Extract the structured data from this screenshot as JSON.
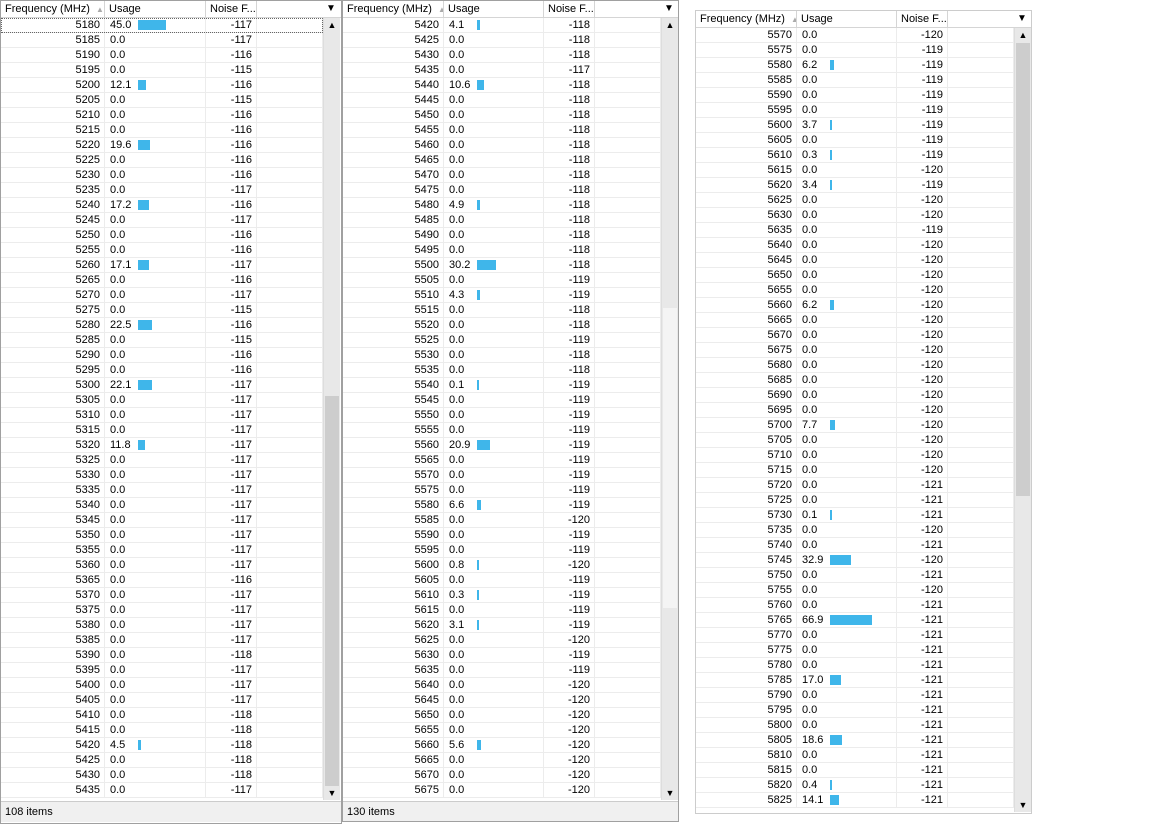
{
  "headers": {
    "frequency": "Frequency (MHz)",
    "usage": "Usage",
    "noise": "Noise F..."
  },
  "colors": {
    "bar": "#3fb6ea"
  },
  "panels": [
    {
      "status": "108 items",
      "rows": [
        [
          "5180",
          "45.0",
          "-117"
        ],
        [
          "5185",
          "0.0",
          "-117"
        ],
        [
          "5190",
          "0.0",
          "-116"
        ],
        [
          "5195",
          "0.0",
          "-115"
        ],
        [
          "5200",
          "12.1",
          "-116"
        ],
        [
          "5205",
          "0.0",
          "-115"
        ],
        [
          "5210",
          "0.0",
          "-116"
        ],
        [
          "5215",
          "0.0",
          "-116"
        ],
        [
          "5220",
          "19.6",
          "-116"
        ],
        [
          "5225",
          "0.0",
          "-116"
        ],
        [
          "5230",
          "0.0",
          "-116"
        ],
        [
          "5235",
          "0.0",
          "-117"
        ],
        [
          "5240",
          "17.2",
          "-116"
        ],
        [
          "5245",
          "0.0",
          "-117"
        ],
        [
          "5250",
          "0.0",
          "-116"
        ],
        [
          "5255",
          "0.0",
          "-116"
        ],
        [
          "5260",
          "17.1",
          "-117"
        ],
        [
          "5265",
          "0.0",
          "-116"
        ],
        [
          "5270",
          "0.0",
          "-117"
        ],
        [
          "5275",
          "0.0",
          "-115"
        ],
        [
          "5280",
          "22.5",
          "-116"
        ],
        [
          "5285",
          "0.0",
          "-115"
        ],
        [
          "5290",
          "0.0",
          "-116"
        ],
        [
          "5295",
          "0.0",
          "-116"
        ],
        [
          "5300",
          "22.1",
          "-117"
        ],
        [
          "5305",
          "0.0",
          "-117"
        ],
        [
          "5310",
          "0.0",
          "-117"
        ],
        [
          "5315",
          "0.0",
          "-117"
        ],
        [
          "5320",
          "11.8",
          "-117"
        ],
        [
          "5325",
          "0.0",
          "-117"
        ],
        [
          "5330",
          "0.0",
          "-117"
        ],
        [
          "5335",
          "0.0",
          "-117"
        ],
        [
          "5340",
          "0.0",
          "-117"
        ],
        [
          "5345",
          "0.0",
          "-117"
        ],
        [
          "5350",
          "0.0",
          "-117"
        ],
        [
          "5355",
          "0.0",
          "-117"
        ],
        [
          "5360",
          "0.0",
          "-117"
        ],
        [
          "5365",
          "0.0",
          "-116"
        ],
        [
          "5370",
          "0.0",
          "-117"
        ],
        [
          "5375",
          "0.0",
          "-117"
        ],
        [
          "5380",
          "0.0",
          "-117"
        ],
        [
          "5385",
          "0.0",
          "-117"
        ],
        [
          "5390",
          "0.0",
          "-118"
        ],
        [
          "5395",
          "0.0",
          "-117"
        ],
        [
          "5400",
          "0.0",
          "-117"
        ],
        [
          "5405",
          "0.0",
          "-117"
        ],
        [
          "5410",
          "0.0",
          "-118"
        ],
        [
          "5415",
          "0.0",
          "-118"
        ],
        [
          "5420",
          "4.5",
          "-118"
        ],
        [
          "5425",
          "0.0",
          "-118"
        ],
        [
          "5430",
          "0.0",
          "-118"
        ],
        [
          "5435",
          "0.0",
          "-117"
        ]
      ]
    },
    {
      "status": "130 items",
      "rows": [
        [
          "5420",
          "4.1",
          "-118"
        ],
        [
          "5425",
          "0.0",
          "-118"
        ],
        [
          "5430",
          "0.0",
          "-118"
        ],
        [
          "5435",
          "0.0",
          "-117"
        ],
        [
          "5440",
          "10.6",
          "-118"
        ],
        [
          "5445",
          "0.0",
          "-118"
        ],
        [
          "5450",
          "0.0",
          "-118"
        ],
        [
          "5455",
          "0.0",
          "-118"
        ],
        [
          "5460",
          "0.0",
          "-118"
        ],
        [
          "5465",
          "0.0",
          "-118"
        ],
        [
          "5470",
          "0.0",
          "-118"
        ],
        [
          "5475",
          "0.0",
          "-118"
        ],
        [
          "5480",
          "4.9",
          "-118"
        ],
        [
          "5485",
          "0.0",
          "-118"
        ],
        [
          "5490",
          "0.0",
          "-118"
        ],
        [
          "5495",
          "0.0",
          "-118"
        ],
        [
          "5500",
          "30.2",
          "-118"
        ],
        [
          "5505",
          "0.0",
          "-119"
        ],
        [
          "5510",
          "4.3",
          "-119"
        ],
        [
          "5515",
          "0.0",
          "-118"
        ],
        [
          "5520",
          "0.0",
          "-118"
        ],
        [
          "5525",
          "0.0",
          "-119"
        ],
        [
          "5530",
          "0.0",
          "-118"
        ],
        [
          "5535",
          "0.0",
          "-118"
        ],
        [
          "5540",
          "0.1",
          "-119"
        ],
        [
          "5545",
          "0.0",
          "-119"
        ],
        [
          "5550",
          "0.0",
          "-119"
        ],
        [
          "5555",
          "0.0",
          "-119"
        ],
        [
          "5560",
          "20.9",
          "-119"
        ],
        [
          "5565",
          "0.0",
          "-119"
        ],
        [
          "5570",
          "0.0",
          "-119"
        ],
        [
          "5575",
          "0.0",
          "-119"
        ],
        [
          "5580",
          "6.6",
          "-119"
        ],
        [
          "5585",
          "0.0",
          "-120"
        ],
        [
          "5590",
          "0.0",
          "-119"
        ],
        [
          "5595",
          "0.0",
          "-119"
        ],
        [
          "5600",
          "0.8",
          "-120"
        ],
        [
          "5605",
          "0.0",
          "-119"
        ],
        [
          "5610",
          "0.3",
          "-119"
        ],
        [
          "5615",
          "0.0",
          "-119"
        ],
        [
          "5620",
          "3.1",
          "-119"
        ],
        [
          "5625",
          "0.0",
          "-120"
        ],
        [
          "5630",
          "0.0",
          "-119"
        ],
        [
          "5635",
          "0.0",
          "-119"
        ],
        [
          "5640",
          "0.0",
          "-120"
        ],
        [
          "5645",
          "0.0",
          "-120"
        ],
        [
          "5650",
          "0.0",
          "-120"
        ],
        [
          "5655",
          "0.0",
          "-120"
        ],
        [
          "5660",
          "5.6",
          "-120"
        ],
        [
          "5665",
          "0.0",
          "-120"
        ],
        [
          "5670",
          "0.0",
          "-120"
        ],
        [
          "5675",
          "0.0",
          "-120"
        ]
      ]
    },
    {
      "rows": [
        [
          "5570",
          "0.0",
          "-120"
        ],
        [
          "5575",
          "0.0",
          "-119"
        ],
        [
          "5580",
          "6.2",
          "-119"
        ],
        [
          "5585",
          "0.0",
          "-119"
        ],
        [
          "5590",
          "0.0",
          "-119"
        ],
        [
          "5595",
          "0.0",
          "-119"
        ],
        [
          "5600",
          "3.7",
          "-119"
        ],
        [
          "5605",
          "0.0",
          "-119"
        ],
        [
          "5610",
          "0.3",
          "-119"
        ],
        [
          "5615",
          "0.0",
          "-120"
        ],
        [
          "5620",
          "3.4",
          "-119"
        ],
        [
          "5625",
          "0.0",
          "-120"
        ],
        [
          "5630",
          "0.0",
          "-120"
        ],
        [
          "5635",
          "0.0",
          "-119"
        ],
        [
          "5640",
          "0.0",
          "-120"
        ],
        [
          "5645",
          "0.0",
          "-120"
        ],
        [
          "5650",
          "0.0",
          "-120"
        ],
        [
          "5655",
          "0.0",
          "-120"
        ],
        [
          "5660",
          "6.2",
          "-120"
        ],
        [
          "5665",
          "0.0",
          "-120"
        ],
        [
          "5670",
          "0.0",
          "-120"
        ],
        [
          "5675",
          "0.0",
          "-120"
        ],
        [
          "5680",
          "0.0",
          "-120"
        ],
        [
          "5685",
          "0.0",
          "-120"
        ],
        [
          "5690",
          "0.0",
          "-120"
        ],
        [
          "5695",
          "0.0",
          "-120"
        ],
        [
          "5700",
          "7.7",
          "-120"
        ],
        [
          "5705",
          "0.0",
          "-120"
        ],
        [
          "5710",
          "0.0",
          "-120"
        ],
        [
          "5715",
          "0.0",
          "-120"
        ],
        [
          "5720",
          "0.0",
          "-121"
        ],
        [
          "5725",
          "0.0",
          "-121"
        ],
        [
          "5730",
          "0.1",
          "-121"
        ],
        [
          "5735",
          "0.0",
          "-120"
        ],
        [
          "5740",
          "0.0",
          "-121"
        ],
        [
          "5745",
          "32.9",
          "-120"
        ],
        [
          "5750",
          "0.0",
          "-121"
        ],
        [
          "5755",
          "0.0",
          "-120"
        ],
        [
          "5760",
          "0.0",
          "-121"
        ],
        [
          "5765",
          "66.9",
          "-121"
        ],
        [
          "5770",
          "0.0",
          "-121"
        ],
        [
          "5775",
          "0.0",
          "-121"
        ],
        [
          "5780",
          "0.0",
          "-121"
        ],
        [
          "5785",
          "17.0",
          "-121"
        ],
        [
          "5790",
          "0.0",
          "-121"
        ],
        [
          "5795",
          "0.0",
          "-121"
        ],
        [
          "5800",
          "0.0",
          "-121"
        ],
        [
          "5805",
          "18.6",
          "-121"
        ],
        [
          "5810",
          "0.0",
          "-121"
        ],
        [
          "5815",
          "0.0",
          "-121"
        ],
        [
          "5820",
          "0.4",
          "-121"
        ],
        [
          "5825",
          "14.1",
          "-121"
        ]
      ]
    }
  ]
}
